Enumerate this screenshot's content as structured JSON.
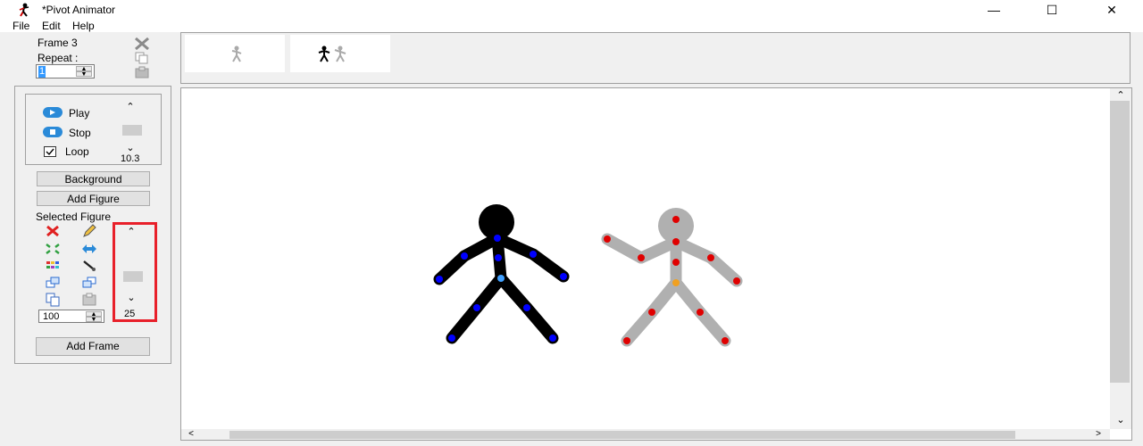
{
  "window": {
    "title": "*Pivot Animator",
    "minimize": "—",
    "maximize": "☐",
    "close": "✕"
  },
  "menu": [
    "File",
    "Edit",
    "Help"
  ],
  "frame_panel": {
    "frame_label": "Frame 3",
    "repeat_label": "Repeat :",
    "repeat_value": "1"
  },
  "playback": {
    "play_label": "Play",
    "stop_label": "Stop",
    "loop_label": "Loop",
    "speed_value": "10.3"
  },
  "buttons": {
    "background": "Background",
    "add_figure": "Add Figure",
    "add_frame": "Add Frame"
  },
  "selected_figure": {
    "label": "Selected Figure",
    "size_value": "100",
    "scroll_value": "25"
  },
  "colors": {
    "highlight_box": "#e8202a",
    "active_joint": "#0000ff",
    "inactive_joint": "#e00000",
    "origin_joint": "#f0a020",
    "figure_active": "#000000",
    "figure_inactive": "#b0b0b0"
  }
}
